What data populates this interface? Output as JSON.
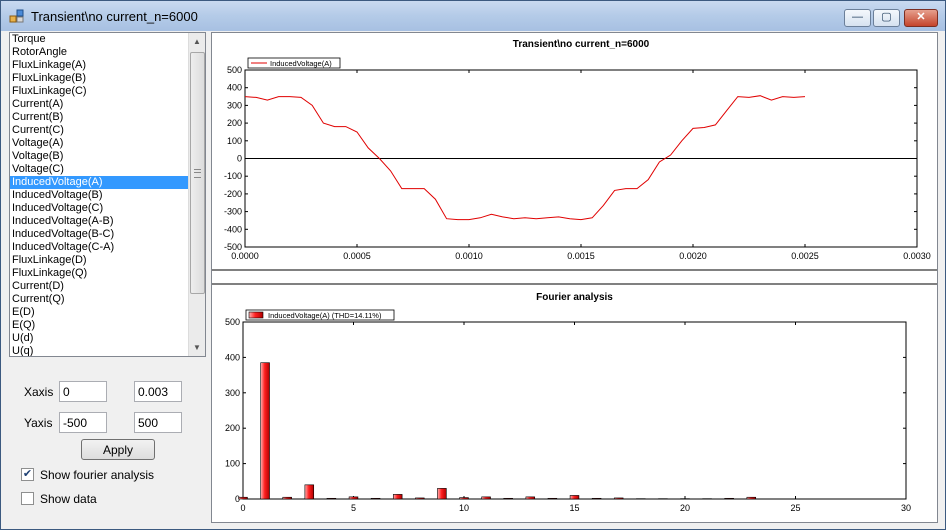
{
  "window": {
    "title": "Transient\\no current_n=6000"
  },
  "titlebar_buttons": {
    "minimize": "—",
    "maximize": "▢",
    "close": "✕"
  },
  "list": {
    "items": [
      "Torque",
      "RotorAngle",
      "FluxLinkage(A)",
      "FluxLinkage(B)",
      "FluxLinkage(C)",
      "Current(A)",
      "Current(B)",
      "Current(C)",
      "Voltage(A)",
      "Voltage(B)",
      "Voltage(C)",
      "InducedVoltage(A)",
      "InducedVoltage(B)",
      "InducedVoltage(C)",
      "InducedVoltage(A-B)",
      "InducedVoltage(B-C)",
      "InducedVoltage(C-A)",
      "FluxLinkage(D)",
      "FluxLinkage(Q)",
      "Current(D)",
      "Current(Q)",
      "E(D)",
      "E(Q)",
      "U(d)",
      "U(q)"
    ],
    "selected": "InducedVoltage(A)"
  },
  "controls": {
    "xaxis_label": "Xaxis",
    "xaxis_min": "0",
    "xaxis_max": "0.003",
    "yaxis_label": "Yaxis",
    "yaxis_min": "-500",
    "yaxis_max": "500",
    "apply_label": "Apply",
    "show_fourier_label": "Show fourier analysis",
    "show_fourier_checked": true,
    "show_data_label": "Show data",
    "show_data_checked": false
  },
  "colors": {
    "series": "#e00000",
    "selection": "#3399ff"
  },
  "chart_data": [
    {
      "type": "line",
      "title": "Transient\\no current_n=6000",
      "xlim": [
        0,
        0.003
      ],
      "ylim": [
        -500,
        500
      ],
      "x_ticks": [
        "0.0000",
        "0.0005",
        "0.0010",
        "0.0015",
        "0.0020",
        "0.0025",
        "0.0030"
      ],
      "y_ticks": [
        "500",
        "400",
        "300",
        "200",
        "100",
        "0",
        "-100",
        "-200",
        "-300",
        "-400",
        "-500"
      ],
      "legend": "top-left",
      "series": [
        {
          "name": "InducedVoltage(A)",
          "x": [
            0,
            5e-05,
            0.0001,
            0.00015,
            0.0002,
            0.00025,
            0.0003,
            0.00035,
            0.0004,
            0.00045,
            0.0005,
            0.00055,
            0.0006,
            0.00065,
            0.0007,
            0.00075,
            0.0008,
            0.00085,
            0.0009,
            0.00095,
            0.001,
            0.00105,
            0.0011,
            0.00115,
            0.0012,
            0.00125,
            0.0013,
            0.00135,
            0.0014,
            0.00145,
            0.0015,
            0.00155,
            0.0016,
            0.00165,
            0.0017,
            0.00175,
            0.0018,
            0.00185,
            0.0019,
            0.00195,
            0.002,
            0.00205,
            0.0021,
            0.00215,
            0.0022,
            0.00225,
            0.0023,
            0.00235,
            0.0024,
            0.00245,
            0.0025
          ],
          "y": [
            350,
            345,
            330,
            350,
            350,
            345,
            300,
            200,
            180,
            180,
            150,
            60,
            0,
            -70,
            -170,
            -170,
            -170,
            -230,
            -340,
            -345,
            -345,
            -335,
            -315,
            -330,
            -340,
            -335,
            -340,
            -335,
            -330,
            -340,
            -345,
            -335,
            -265,
            -180,
            -170,
            -170,
            -120,
            -20,
            20,
            100,
            170,
            175,
            190,
            270,
            350,
            345,
            355,
            330,
            350,
            345,
            350
          ]
        }
      ]
    },
    {
      "type": "bar",
      "title": "Fourier analysis",
      "xlim": [
        0,
        30
      ],
      "ylim": [
        0,
        500
      ],
      "x_ticks": [
        "0",
        "5",
        "10",
        "15",
        "20",
        "25",
        "30"
      ],
      "y_ticks": [
        "500",
        "400",
        "300",
        "200",
        "100",
        "0"
      ],
      "legend": "top-left",
      "series": [
        {
          "name": "InducedVoltage(A) (THD=14.11%)",
          "x": [
            0,
            1,
            2,
            3,
            4,
            5,
            6,
            7,
            8,
            9,
            10,
            11,
            12,
            13,
            14,
            15,
            16,
            17,
            18,
            19,
            20,
            21,
            22,
            23
          ],
          "values": [
            5,
            385,
            5,
            40,
            2,
            6,
            2,
            13,
            3,
            30,
            4,
            6,
            2,
            6,
            2,
            10,
            2,
            3,
            1,
            1,
            1,
            1,
            2,
            5
          ]
        }
      ]
    }
  ]
}
